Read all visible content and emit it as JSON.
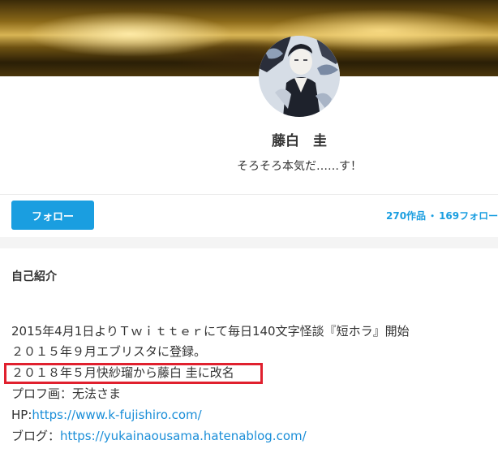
{
  "profile": {
    "name": "藤白　圭",
    "catchphrase": "そろそろ本気だ……す！",
    "follow_label": "フォロー",
    "works": "270作品",
    "separator": "・",
    "followers": "169フォロー"
  },
  "intro": {
    "heading": "自己紹介",
    "lines": [
      "2015年4月1日よりＴｗｉｔｔｅｒにて毎日140文字怪談『短ホラ』開始",
      "２０１５年９月エブリスタに登録。",
      "２０１８年５月快紗瑠から藤白 圭に改名",
      "プロフ画：无法さま"
    ],
    "hp_prefix": "HP:",
    "hp_url": "https://www.k-fujishiro.com/",
    "blog_prefix": "ブログ：",
    "blog_url": "https://yukainaousama.hatenablog.com/"
  },
  "colors": {
    "accent": "#1a9ee0",
    "link": "#1a8ed8",
    "highlight": "#e0202e"
  },
  "icons": {
    "avatar": "avatar-illustration",
    "cover": "golden-cover-image"
  }
}
